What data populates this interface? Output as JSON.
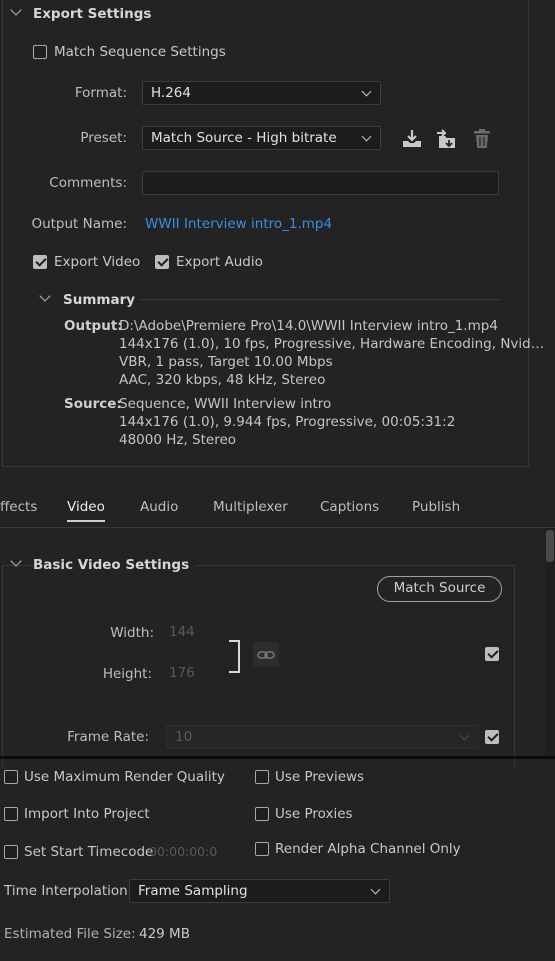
{
  "export_settings": {
    "title": "Export Settings",
    "match_sequence": {
      "label": "Match Sequence Settings",
      "checked": false
    },
    "format": {
      "label": "Format:",
      "value": "H.264"
    },
    "preset": {
      "label": "Preset:",
      "value": "Match Source - High bitrate"
    },
    "comments": {
      "label": "Comments:",
      "value": ""
    },
    "output_name": {
      "label": "Output Name:",
      "value": "WWII Interview intro_1.mp4"
    },
    "export_video": {
      "label": "Export Video",
      "checked": true
    },
    "export_audio": {
      "label": "Export Audio",
      "checked": true
    },
    "summary": {
      "title": "Summary",
      "output_key": "Output:",
      "output_lines": [
        "D:\\Adobe\\Premiere Pro\\14.0\\WWII Interview intro_1.mp4",
        "144x176 (1.0), 10 fps, Progressive, Hardware Encoding, Nvid…",
        "VBR, 1 pass, Target 10.00 Mbps",
        "AAC, 320 kbps, 48 kHz, Stereo"
      ],
      "source_key": "Source:",
      "source_lines": [
        "Sequence, WWII Interview intro",
        "144x176 (1.0), 9.944 fps, Progressive, 00:05:31:2",
        "48000 Hz, Stereo"
      ]
    }
  },
  "tabs": [
    {
      "label": "ffects",
      "active": false
    },
    {
      "label": "Video",
      "active": true
    },
    {
      "label": "Audio",
      "active": false
    },
    {
      "label": "Multiplexer",
      "active": false
    },
    {
      "label": "Captions",
      "active": false
    },
    {
      "label": "Publish",
      "active": false
    }
  ],
  "basic_video": {
    "title": "Basic Video Settings",
    "match_source_label": "Match Source",
    "width": {
      "label": "Width:",
      "value": "144"
    },
    "height": {
      "label": "Height:",
      "value": "176"
    },
    "frame_rate": {
      "label": "Frame Rate:",
      "value": "10"
    }
  },
  "bottom": {
    "use_max_render_quality": {
      "label": "Use Maximum Render Quality",
      "checked": false
    },
    "use_previews": {
      "label": "Use Previews",
      "checked": false
    },
    "import_into_project": {
      "label": "Import Into Project",
      "checked": false
    },
    "use_proxies": {
      "label": "Use Proxies",
      "checked": false
    },
    "set_start_timecode": {
      "label": "Set Start Timecode",
      "checked": false,
      "value": "00:00:00:0"
    },
    "render_alpha": {
      "label": "Render Alpha Channel Only",
      "checked": false
    },
    "time_interpolation": {
      "label": "Time Interpolation:",
      "value": "Frame Sampling"
    },
    "estimated_file_size": {
      "label": "Estimated File Size:",
      "value": "429 MB"
    }
  },
  "colors": {
    "accent_link": "#3b8ee0",
    "panel_bg": "#232323",
    "field_bg": "#1c1c1c"
  },
  "icons": [
    "chevron-down-icon",
    "save-preset-icon",
    "import-preset-icon",
    "delete-preset-icon",
    "link-icon",
    "checkbox-icon"
  ]
}
